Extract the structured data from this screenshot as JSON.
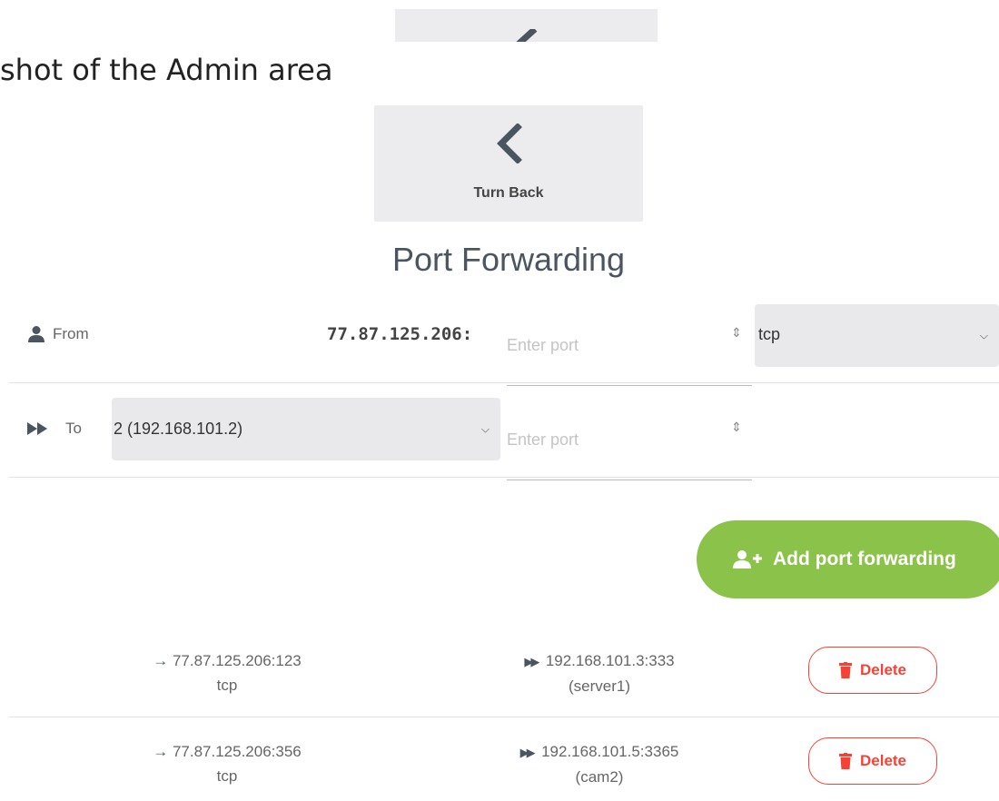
{
  "caption": "shot of the Admin area",
  "back_button": {
    "label": "Turn Back"
  },
  "page_title": "Port Forwarding",
  "from_row": {
    "label": "From",
    "ip_prefix": "77.87.125.206:",
    "port_placeholder": "Enter port",
    "protocol_selected": "tcp"
  },
  "to_row": {
    "label": "To",
    "target_selected": "2 (192.168.101.2)",
    "port_placeholder": "Enter port"
  },
  "add_button": {
    "label": "Add port forwarding"
  },
  "forwards": [
    {
      "source": "77.87.125.206:123",
      "protocol": "tcp",
      "destination": "192.168.101.3:333",
      "name": "(server1)",
      "delete_label": "Delete"
    },
    {
      "source": "77.87.125.206:356",
      "protocol": "tcp",
      "destination": "192.168.101.5:3365",
      "name": "(cam2)",
      "delete_label": "Delete"
    }
  ],
  "colors": {
    "accent_green": "#8bc34a",
    "delete_red": "#f44336",
    "button_gray": "#ececef",
    "title": "#4a5560"
  },
  "icons": {
    "back": "chevron-left-icon",
    "from": "user-icon",
    "to": "fast-forward-icon",
    "add": "user-plus-icon",
    "source": "arrow-right-icon",
    "destination": "fast-forward-icon",
    "delete": "trash-icon"
  }
}
